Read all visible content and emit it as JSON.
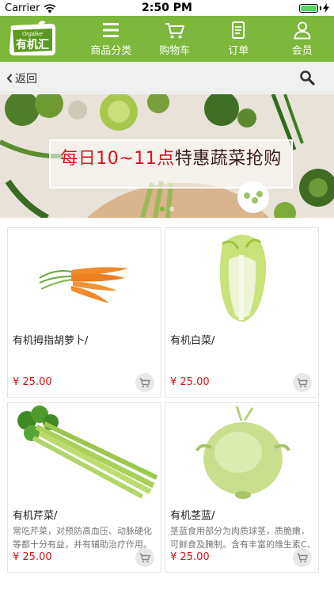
{
  "status_bar": {
    "carrier": "Carrier",
    "time": "2:50 PM",
    "battery_level": 1.0
  },
  "header": {
    "logo_top": "Orgalive",
    "logo_main": "有机汇",
    "nav": [
      {
        "label": "商品分类",
        "icon": "menu-icon"
      },
      {
        "label": "购物车",
        "icon": "cart-icon"
      },
      {
        "label": "订单",
        "icon": "order-icon"
      },
      {
        "label": "会员",
        "icon": "user-icon"
      }
    ],
    "colors": {
      "brand_green": "#7cb83b",
      "price_red": "#d8121c"
    }
  },
  "backbar": {
    "back_label": "返回",
    "search_icon": "search-icon"
  },
  "banner": {
    "text_part1": "每日10~11点",
    "text_part2": "特惠蔬菜抢购",
    "slides": 2,
    "active_slide": 1
  },
  "products": [
    {
      "name": "有机拇指胡萝卜/",
      "description": "",
      "price": "¥ 25.00",
      "image": "carrot"
    },
    {
      "name": "有机白菜/",
      "description": "",
      "price": "¥ 25.00",
      "image": "cabbage"
    },
    {
      "name": "有机芹菜/",
      "description": "常吃芹菜，对预防高血压、动脉硬化等都十分有益，并有辅助治疗作用。",
      "price": "¥ 25.00",
      "image": "celery"
    },
    {
      "name": "有机茎蓝/",
      "description": "茎蓝食用部分为肉质球茎，质脆嫩，可鲜食及腌制。含有丰富的维生素C、膳食纤维，维生素E等抗癌防衰老",
      "price": "¥ 25.00",
      "image": "kohlrabi"
    }
  ]
}
